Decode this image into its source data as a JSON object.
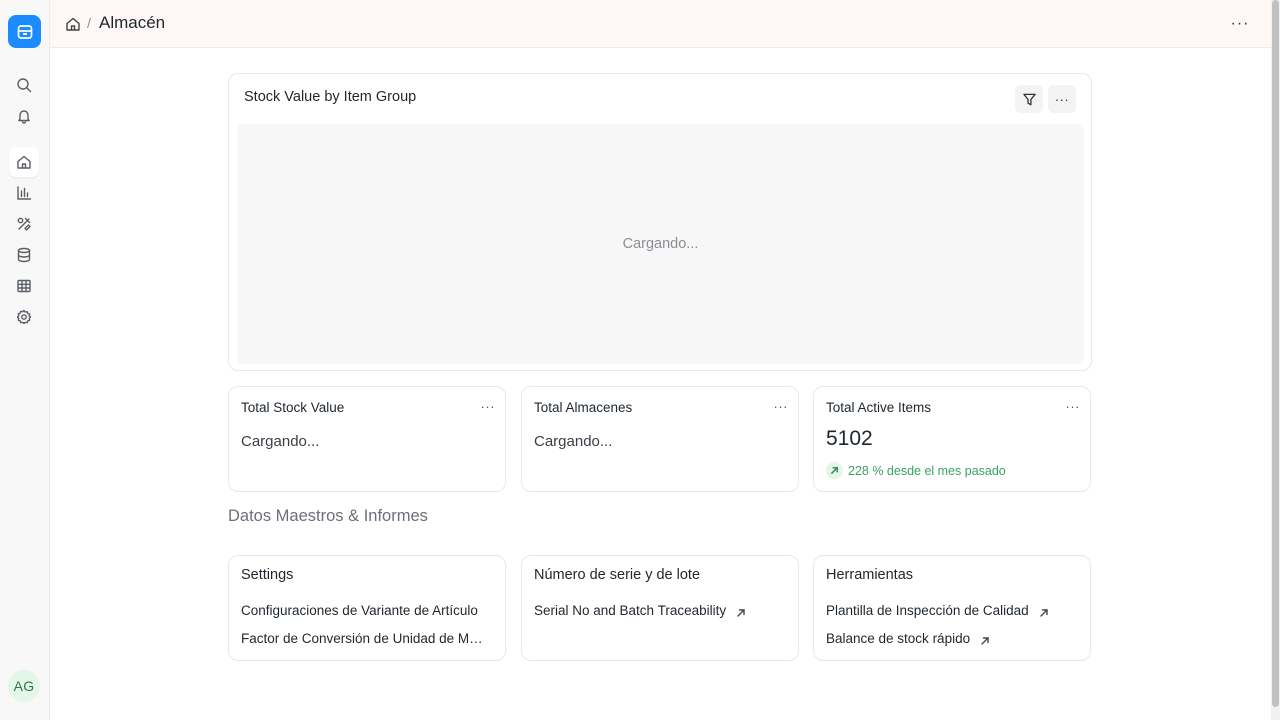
{
  "breadcrumb": {
    "separator": "/",
    "title": "Almacén"
  },
  "top_more": "···",
  "sidebar": {
    "items": [
      {
        "name": "search-icon"
      },
      {
        "name": "bell-icon"
      },
      {
        "name": "home-icon",
        "active": true
      },
      {
        "name": "bar-chart-icon"
      },
      {
        "name": "tools-icon"
      },
      {
        "name": "database-icon"
      },
      {
        "name": "table-icon"
      },
      {
        "name": "gear-icon"
      }
    ],
    "avatar": "AG"
  },
  "chart_card": {
    "title": "Stock Value by Item Group",
    "loading": "Cargando..."
  },
  "number_cards": [
    {
      "label": "Total Stock Value",
      "more": "···",
      "loading": "Cargando..."
    },
    {
      "label": "Total Almacenes",
      "more": "···",
      "loading": "Cargando..."
    },
    {
      "label": "Total Active Items",
      "more": "···",
      "value": "5102",
      "delta": "228 % desde el mes pasado"
    }
  ],
  "section_title": "Datos Maestros & Informes",
  "link_cards": [
    {
      "title": "Settings",
      "links": [
        "Configuraciones de Variante de Artículo",
        "Factor de Conversión de Unidad de Medida"
      ]
    },
    {
      "title": "Número de serie y de lote",
      "links": [
        "Serial No and Batch Traceability"
      ]
    },
    {
      "title": "Herramientas",
      "links": [
        "Plantilla de Inspección de Calidad",
        "Balance de stock rápido"
      ]
    }
  ],
  "colors": {
    "accent": "#1a8cff",
    "positive": "#3aa361",
    "topbar_bg": "#fdf8f5"
  }
}
